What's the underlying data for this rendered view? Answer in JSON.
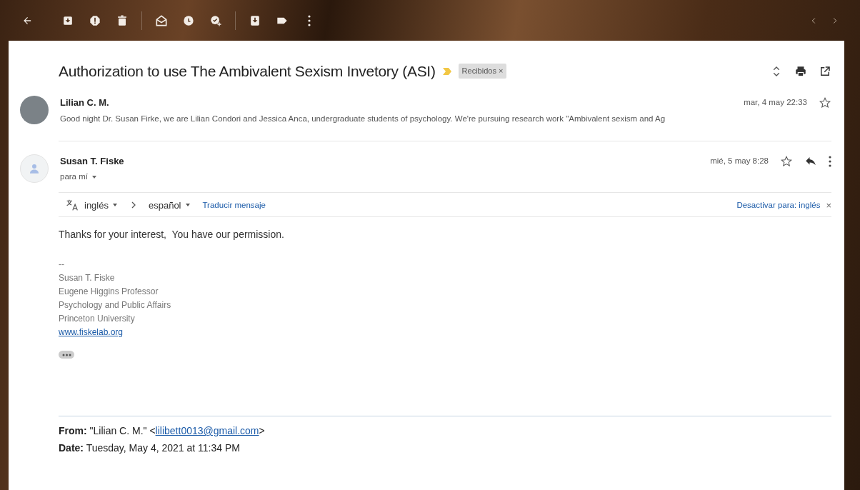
{
  "subject": {
    "title": "Authorization to use The Ambivalent Sexism Invetory (ASI)",
    "label": "Recibidos",
    "label_close": "×"
  },
  "messages": [
    {
      "kind": "collapsed",
      "sender": "Lilian C. M.",
      "date": "mar, 4 may 22:33",
      "starred": false,
      "snippet": "Good night Dr. Susan Firke, we are Lilian Condori and Jessica Anca, undergraduate students of psychology. We're pursuing research work \"Ambivalent sexism and Ag"
    },
    {
      "kind": "expanded",
      "sender": "Susan T. Fiske",
      "recipient": "para mí",
      "date": "mié, 5 may 8:28",
      "starred": false,
      "translate": {
        "from": "inglés",
        "to": "español",
        "action": "Traducir mensaje",
        "disable": "Desactivar para: inglés",
        "close": "×"
      },
      "body": "Thanks for your interest,  You have our permission.",
      "signature": [
        "--",
        "Susan T. Fiske",
        "Eugene Higgins Professor",
        "Psychology and Public Affairs",
        "Princeton University"
      ],
      "signature_link": "www.fiskelab.org",
      "quoted": [
        {
          "text": "**From:** \"Lilian C. M.\" <",
          "link": "lilibett0013@gmail.com",
          "after": ">"
        },
        {
          "text": "**Date:** Tuesday, May 4, 2021 at 11:34 PM"
        }
      ]
    }
  ]
}
